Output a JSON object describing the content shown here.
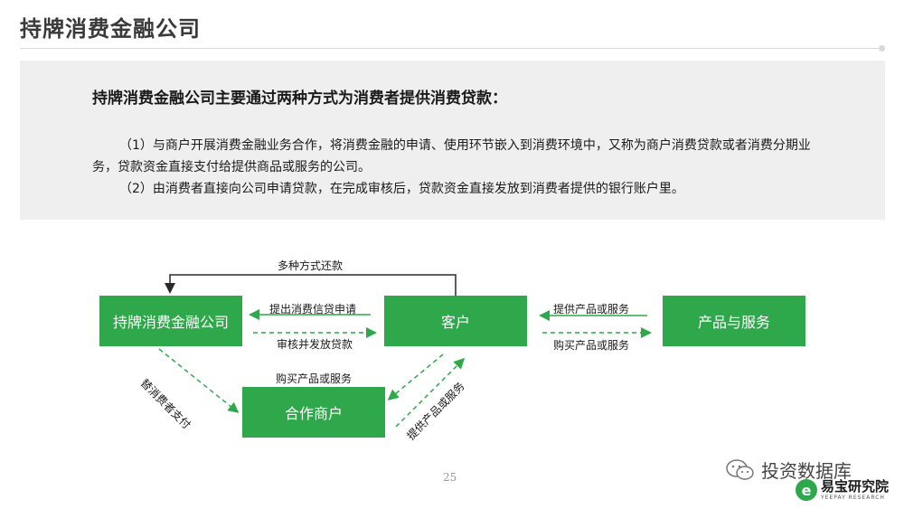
{
  "header": {
    "title": "持牌消费金融公司"
  },
  "intro": {
    "heading": "持牌消费金融公司主要通过两种方式为消费者提供消费贷款：",
    "para1": "（1）与商户开展消费金融业务合作，将消费金融的申请、使用环节嵌入到消费环境中，又称为商户消费贷款或者消费分期业务，贷款资金直接支付给提供商品或服务的公司。",
    "para2": "（2）由消费者直接向公司申请贷款，在完成审核后，贷款资金直接发放到消费者提供的银行账户里。"
  },
  "diagram": {
    "nodes": {
      "company": "持牌消费金融公司",
      "customer": "客户",
      "product": "产品与服务",
      "merchant": "合作商户"
    },
    "edges": {
      "repay": "多种方式还款",
      "apply": "提出消费信贷申请",
      "approve": "审核并发放贷款",
      "provide_top": "提供产品或服务",
      "buy_top": "购买产品或服务",
      "pay_for": "替消费者支付",
      "buy_merchant": "购买产品或服务",
      "provide_merchant": "提供产品或服务"
    },
    "colors": {
      "node": "#2ea84a",
      "arrow": "#2ea84a"
    }
  },
  "footer": {
    "page": "25",
    "watermark": "投资数据库",
    "logo_name": "易宝研究院",
    "logo_sub": "YEEPAY RESEARCH",
    "logo_mark": "e"
  }
}
